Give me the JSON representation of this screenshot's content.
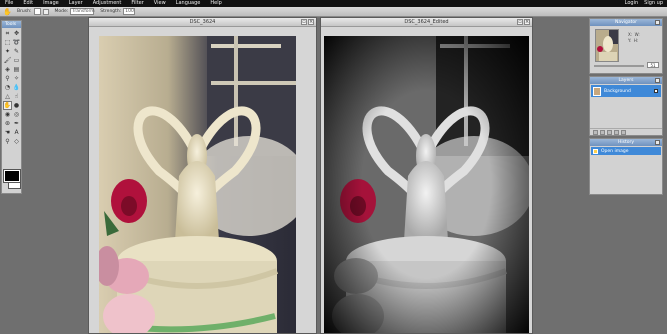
{
  "menu": {
    "items": [
      "File",
      "Edit",
      "Image",
      "Layer",
      "Adjustment",
      "Filter",
      "View",
      "Language",
      "Help"
    ],
    "login": "Login",
    "signup": "Sign up"
  },
  "options": {
    "brush_label": "Brush:",
    "mode_label": "Mode:",
    "mode_value": "Transform",
    "strength_label": "Strength:",
    "strength_value": "100"
  },
  "tools": {
    "title": "Tools"
  },
  "windows": {
    "left_title": "DSC_3624",
    "right_title": "DSC_3624_Edited"
  },
  "navigator": {
    "title": "Navigator",
    "x_label": "X:",
    "y_label": "Y:",
    "w_label": "W:",
    "h_label": "H:",
    "zoom": "51"
  },
  "layers": {
    "title": "Layers",
    "items": [
      {
        "name": "Background"
      }
    ]
  },
  "history": {
    "title": "History",
    "items": [
      {
        "name": "Open image"
      }
    ]
  },
  "colors": {
    "foreground": "#000000",
    "background": "#ffffff",
    "accent": "#3f89d8"
  }
}
